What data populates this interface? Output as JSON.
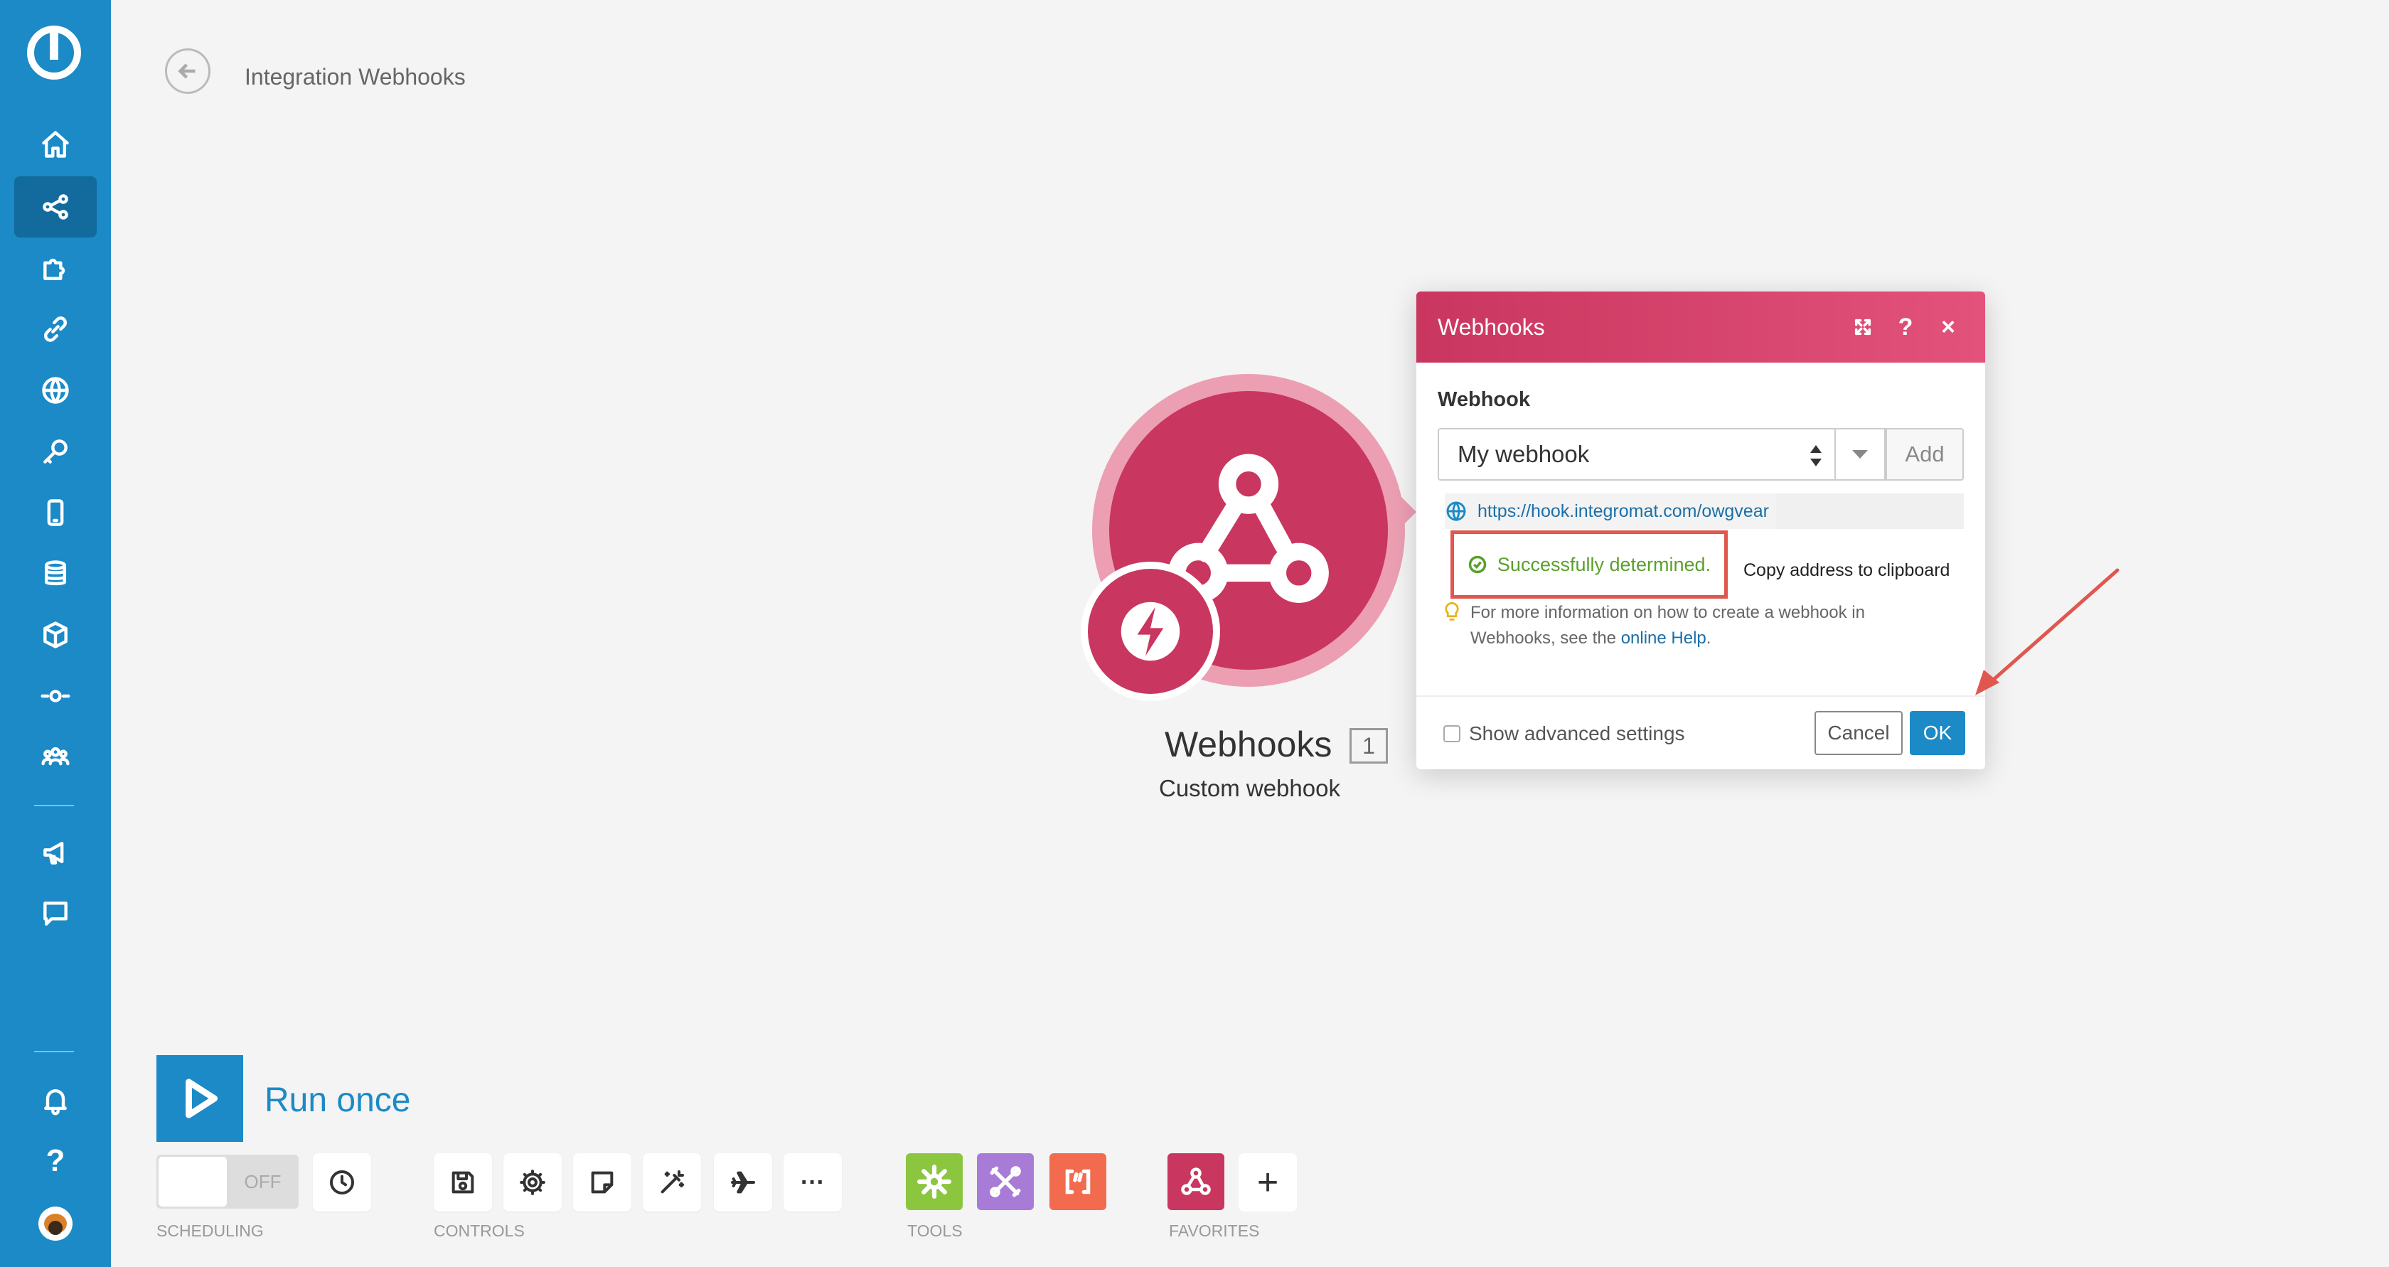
{
  "header": {
    "title": "Integration Webhooks"
  },
  "sidebar": {
    "items": [
      {
        "icon": "home-icon"
      },
      {
        "icon": "scenarios-icon",
        "active": true
      },
      {
        "icon": "puzzle-icon"
      },
      {
        "icon": "link-icon"
      },
      {
        "icon": "globe-icon"
      },
      {
        "icon": "key-icon"
      },
      {
        "icon": "device-icon"
      },
      {
        "icon": "database-icon"
      },
      {
        "icon": "box-icon"
      },
      {
        "icon": "flow-icon"
      },
      {
        "icon": "team-icon"
      },
      {
        "icon": "megaphone-icon"
      },
      {
        "icon": "chat-icon"
      },
      {
        "icon": "bell-icon"
      },
      {
        "icon": "help-icon"
      },
      {
        "icon": "avatar"
      }
    ],
    "help_label": "?"
  },
  "module": {
    "name": "Webhooks",
    "count": "1",
    "subtitle": "Custom webhook",
    "color": "#c9365f"
  },
  "dialog": {
    "title": "Webhooks",
    "help_label": "?",
    "close_label": "×",
    "field_label": "Webhook",
    "selected_webhook": "My webhook",
    "add_label": "Add",
    "url": "https://hook.integromat.com/owgvear",
    "success_text": "Successfully determined.",
    "copy_label": "Copy address to clipboard",
    "hint_text": "For more information on how to create a webhook in Webhooks, see the ",
    "hint_link": "online Help",
    "hint_end": ".",
    "advanced_label": "Show advanced settings",
    "cancel_label": "Cancel",
    "ok_label": "OK"
  },
  "toolbar": {
    "run_label": "Run once",
    "toggle_label": "OFF",
    "scheduling_label": "SCHEDULING",
    "controls_label": "CONTROLS",
    "tools_label": "TOOLS",
    "favorites_label": "FAVORITES",
    "more_label": "···",
    "plus_label": "+"
  },
  "colors": {
    "sidebar": "#1b8ac6",
    "accent": "#1b8ac6",
    "webhook": "#c9365f",
    "success": "#5aa02c",
    "highlight": "#e0574f",
    "tool_green": "#8cc63f",
    "tool_purple": "#a77bd6",
    "tool_orange": "#f26b4f"
  }
}
